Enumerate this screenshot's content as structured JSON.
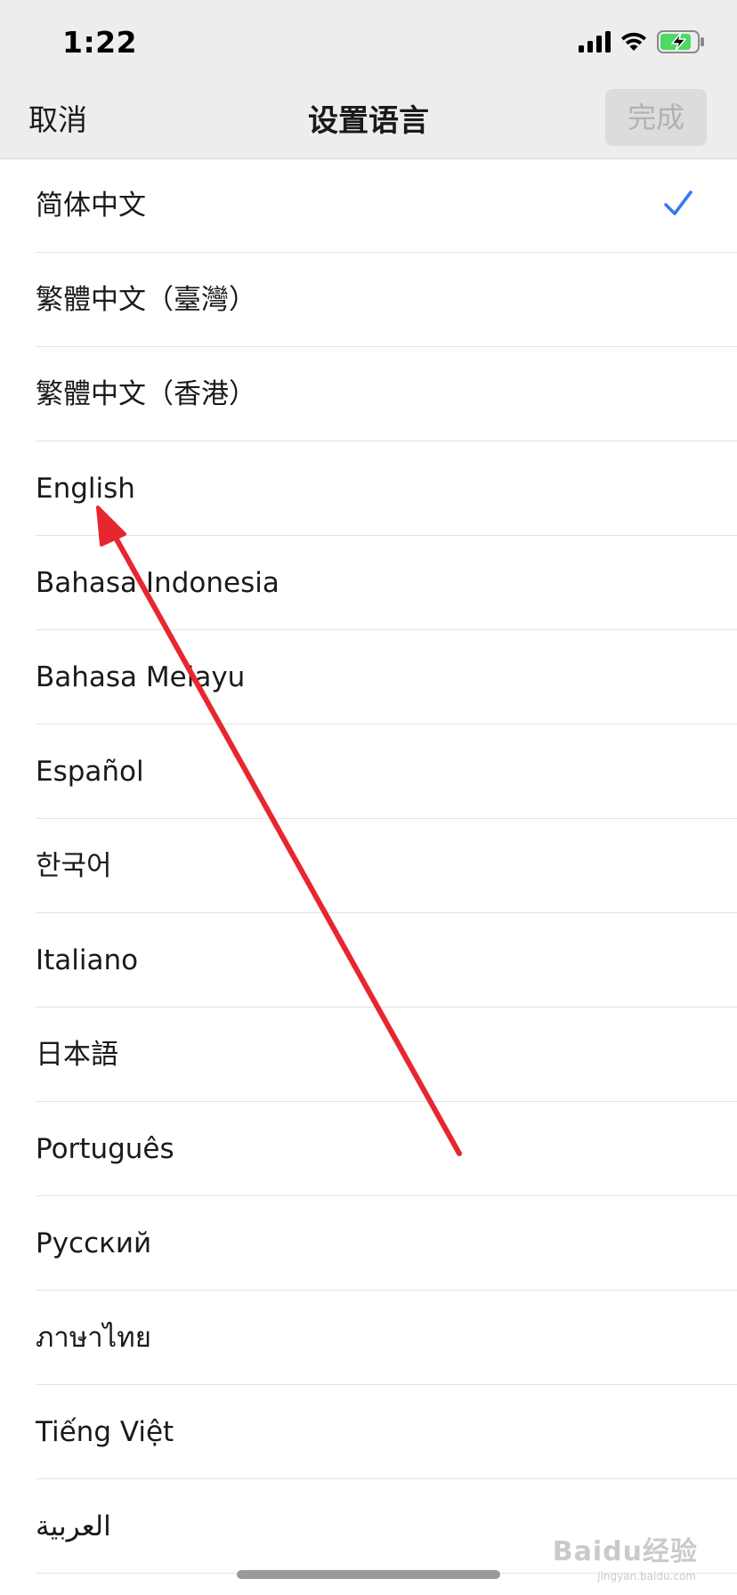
{
  "status_bar": {
    "time": "1:22",
    "icons": [
      "cellular-signal-icon",
      "wifi-icon",
      "battery-charging-icon"
    ]
  },
  "nav": {
    "cancel_label": "取消",
    "title": "设置语言",
    "done_label": "完成"
  },
  "colors": {
    "header_bg": "#ededed",
    "check": "#3478f6",
    "done_disabled_bg": "#dcdcdc",
    "done_disabled_text": "#b2b2b2",
    "annotation_arrow": "#e8262f"
  },
  "languages": [
    {
      "label": "简体中文",
      "selected": true
    },
    {
      "label": "繁體中文（臺灣）",
      "selected": false
    },
    {
      "label": "繁體中文（香港）",
      "selected": false
    },
    {
      "label": "English",
      "selected": false
    },
    {
      "label": "Bahasa Indonesia",
      "selected": false
    },
    {
      "label": "Bahasa Melayu",
      "selected": false
    },
    {
      "label": "Español",
      "selected": false
    },
    {
      "label": "한국어",
      "selected": false
    },
    {
      "label": "Italiano",
      "selected": false
    },
    {
      "label": "日本語",
      "selected": false
    },
    {
      "label": "Português",
      "selected": false
    },
    {
      "label": "Русский",
      "selected": false
    },
    {
      "label": "ภาษาไทย",
      "selected": false
    },
    {
      "label": "Tiếng Việt",
      "selected": false
    },
    {
      "label": "العربية",
      "selected": false
    }
  ],
  "watermark": {
    "text": "Baidu经验",
    "sub": "jingyan.baidu.com"
  }
}
